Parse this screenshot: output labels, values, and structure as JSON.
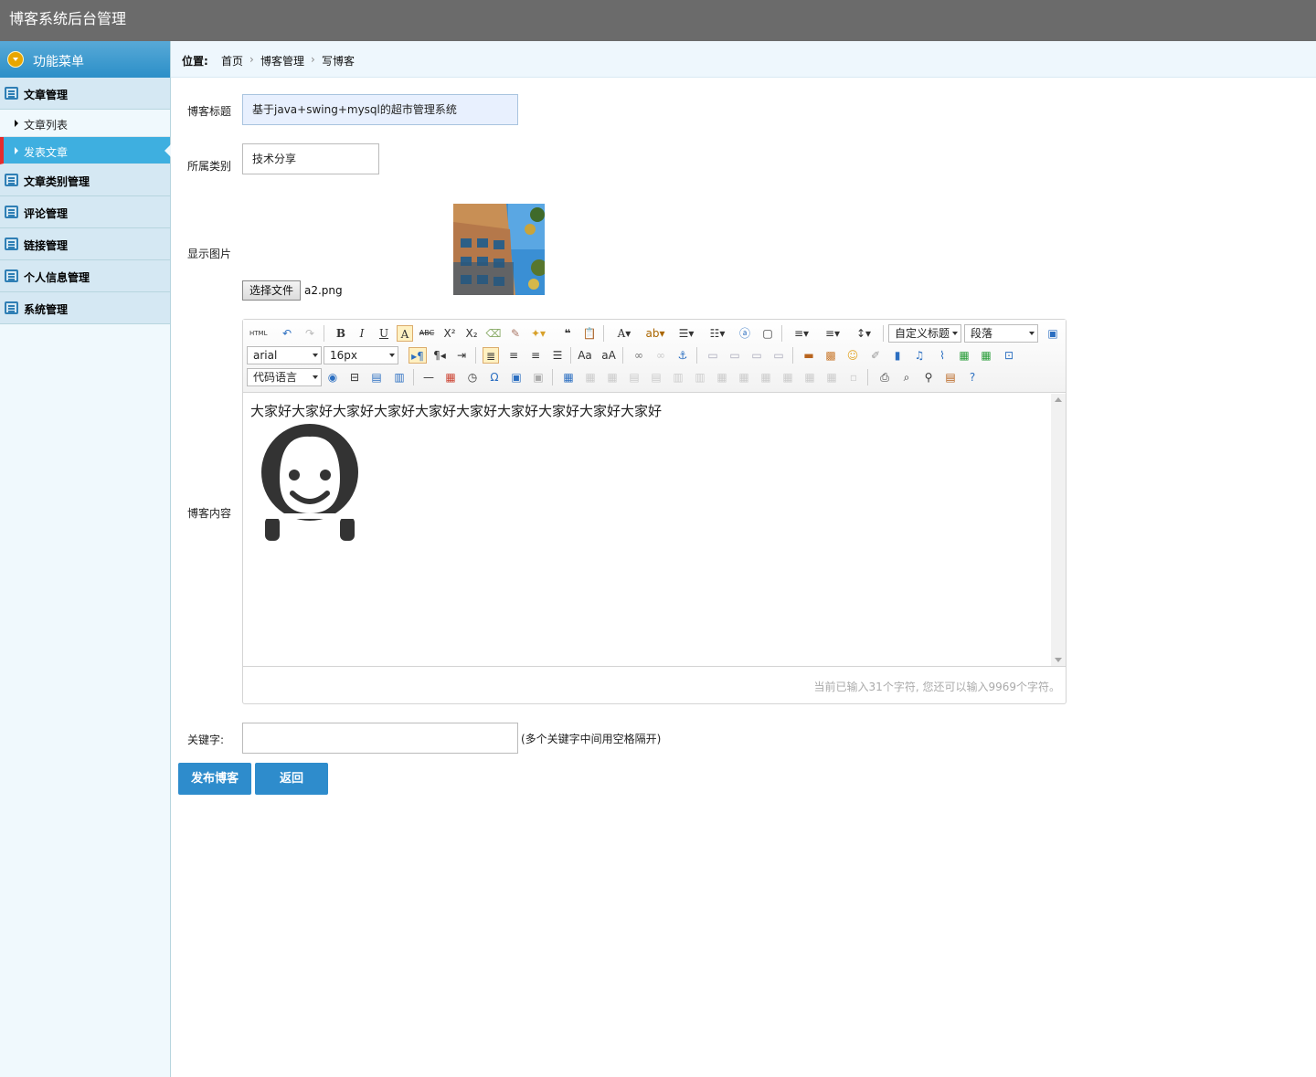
{
  "app": {
    "title": "博客系统后台管理"
  },
  "sidebar": {
    "header": "功能菜单",
    "sections": [
      {
        "label": "文章管理",
        "icon": "list-icon"
      },
      {
        "label": "文章类别管理",
        "icon": "calendar-icon"
      },
      {
        "label": "评论管理",
        "icon": "comment-icon"
      },
      {
        "label": "链接管理",
        "icon": "list-icon"
      },
      {
        "label": "个人信息管理",
        "icon": "edit-icon"
      },
      {
        "label": "系统管理",
        "icon": "list-icon"
      }
    ],
    "sub_items": [
      {
        "label": "文章列表",
        "active": false
      },
      {
        "label": "发表文章",
        "active": true
      }
    ]
  },
  "breadcrumb": {
    "label": "位置:",
    "items": [
      "首页",
      "博客管理",
      "写博客"
    ]
  },
  "form": {
    "title_label": "博客标题",
    "title_value": "基于java+swing+mysql的超市管理系统",
    "category_label": "所属类别",
    "category_value": "技术分享",
    "image_label": "显示图片",
    "file_button": "选择文件",
    "file_name": "a2.png",
    "content_label": "博客内容",
    "keywords_label": "关键字:",
    "keywords_value": "",
    "keywords_hint": "(多个关键字中间用空格隔开)"
  },
  "editor": {
    "font_family": "arial",
    "font_size": "16px",
    "code_lang": "代码语言",
    "custom_heading": "自定义标题",
    "paragraph": "段落",
    "html_label": "HTML",
    "content_text": "大家好大家好大家好大家好大家好大家好大家好大家好大家好大家好",
    "status": "当前已输入31个字符, 您还可以输入9969个字符。"
  },
  "buttons": {
    "publish": "发布博客",
    "back": "返回"
  },
  "colors": {
    "topbar": "#6b6b6b",
    "accent": "#2e8ccc",
    "active_item": "#3eafe0",
    "active_marker": "#e52c2c"
  }
}
